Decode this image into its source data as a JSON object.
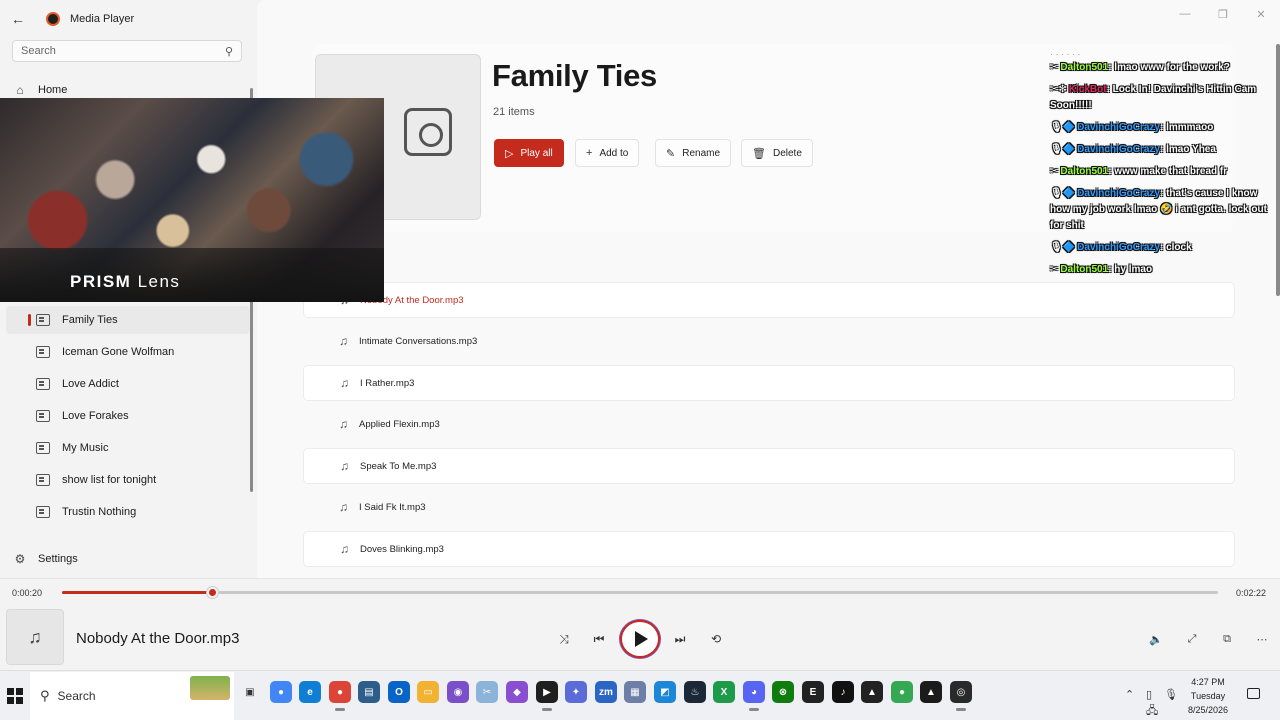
{
  "app": {
    "title": "Media Player",
    "back_glyph": "←"
  },
  "search": {
    "placeholder": "Search"
  },
  "nav": {
    "home": "Home",
    "settings": "Settings"
  },
  "playlists": [
    {
      "label": "Family Ties",
      "active": true
    },
    {
      "label": "Iceman Gone Wolfman"
    },
    {
      "label": "Love Addict"
    },
    {
      "label": "Love Forakes"
    },
    {
      "label": "My Music"
    },
    {
      "label": "show list  for tonight"
    },
    {
      "label": "Trustin Nothing"
    }
  ],
  "playlist": {
    "title": "Family Ties",
    "count": "21 items",
    "actions": {
      "play_all": "Play all",
      "add_to": "Add to",
      "rename": "Rename",
      "delete": "Delete"
    }
  },
  "tracks": [
    {
      "name": "Nobody At the Door.mp3",
      "playing": true
    },
    {
      "name": "Intimate Conversations.mp3"
    },
    {
      "name": "I Rather.mp3"
    },
    {
      "name": "Applied Flexin.mp3"
    },
    {
      "name": "Speak To Me.mp3"
    },
    {
      "name": "I Said Fk It.mp3"
    },
    {
      "name": "Doves Blinking.mp3"
    }
  ],
  "overlay": {
    "brand_bold": "PRISM",
    "brand_light": " Lens"
  },
  "chat": {
    "messages": [
      {
        "badge": "✂",
        "user": "Dalton501",
        "color": "#9cff3c",
        "text": " lmao www for the work?"
      },
      {
        "badge": "✂❇",
        "user": "KickBot",
        "color": "#e0245e",
        "text": " Lock In! Davinchi's Hittin Cam Soon!!!!!"
      },
      {
        "badge": "🎙🔷",
        "user": "DavinchiGoCrazy",
        "color": "#2f9bff",
        "text": " lmmmaoo"
      },
      {
        "badge": "🎙🔷",
        "user": "DavinchiGoCrazy",
        "color": "#2f9bff",
        "text": " lmao Yhea"
      },
      {
        "badge": "✂",
        "user": "Dalton501",
        "color": "#9cff3c",
        "text": " www make that bread fr"
      },
      {
        "badge": "🎙🔷",
        "user": "DavinchiGoCrazy",
        "color": "#2f9bff",
        "text": " that's cause I know how my job work lmao 🤣 i ant gotta. lock out for shit"
      },
      {
        "badge": "🎙🔷",
        "user": "DavinchiGoCrazy",
        "color": "#2f9bff",
        "text": " clock"
      },
      {
        "badge": "✂",
        "user": "Dalton501",
        "color": "#9cff3c",
        "text": " hy lmao"
      }
    ]
  },
  "player": {
    "elapsed": "0:00:20",
    "duration": "0:02:22",
    "progress_fraction": 0.13,
    "now_playing": "Nobody At the Door.mp3"
  },
  "taskbar": {
    "search_label": "Search",
    "time": "4:27 PM",
    "day": "Tuesday",
    "date": "8/25/2026"
  },
  "colors": {
    "accent": "#c42b1c"
  }
}
